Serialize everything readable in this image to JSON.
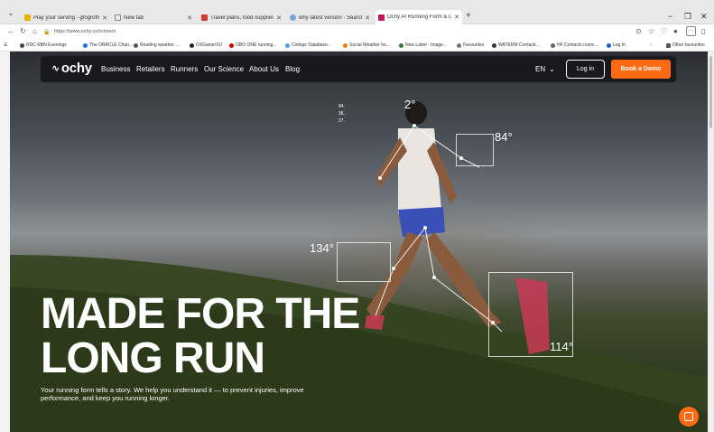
{
  "browser": {
    "tabs": [
      {
        "title": "Play your serving - gfogrofhoumm...",
        "color": "#e8b400"
      },
      {
        "title": "New tab",
        "color": "#888888"
      },
      {
        "title": "Travel plans, food supplies and ad...",
        "color": "#d23b2a"
      },
      {
        "title": "why latest version - Search",
        "color": "#7aa0d6"
      },
      {
        "title": "Ochy AI Running Form & Gait An...",
        "color": "#c2185b"
      }
    ],
    "new_tab_icon": "+",
    "window_controls": [
      "−",
      "❐",
      "✕"
    ],
    "url": "https://www.ochy.co/runners",
    "bookmarks": [
      {
        "label": "RDC RBN Evenings",
        "color": "#444444"
      },
      {
        "label": "The ORACLE Chan...",
        "color": "#1a73e8"
      },
      {
        "label": "Reading weather ...",
        "color": "#555555"
      },
      {
        "label": "DXGamerXU",
        "color": "#222222"
      },
      {
        "label": "OBO ONE running...",
        "color": "#cc0000"
      },
      {
        "label": "College Database...",
        "color": "#4aa3df"
      },
      {
        "label": "Social Weather ho...",
        "color": "#f57c00"
      },
      {
        "label": "New Label - Image...",
        "color": "#2e7d32"
      },
      {
        "label": "Favourites",
        "color": "#777777"
      },
      {
        "label": "WATERM Contacti...",
        "color": "#333333"
      },
      {
        "label": "HF Contacts numc...",
        "color": "#666666"
      },
      {
        "label": "Log In",
        "color": "#1565c0"
      },
      {
        "label": "Other favourites",
        "color": "#555555"
      }
    ]
  },
  "site": {
    "logo": "ochy",
    "logo_mark": "∿",
    "nav": [
      "Business",
      "Retailers",
      "Runners",
      "Our Science",
      "About Us",
      "Blog"
    ],
    "language": "EN",
    "login_label": "Log in",
    "demo_label": "Book a Demo",
    "accent": "#ff6a13"
  },
  "hero": {
    "title_line1": "MADE FOR THE",
    "title_line2": "LONG RUN",
    "subtitle": "Your running form tells a story. We help you understand it — to prevent injuries, improve performance, and keep you running longer."
  },
  "overlay": {
    "head_angle": "2°",
    "elbow_angle": "84°",
    "knee_angle": "134°",
    "ankle_angle": "114°",
    "mini": [
      "84.",
      "36.",
      "27."
    ]
  }
}
